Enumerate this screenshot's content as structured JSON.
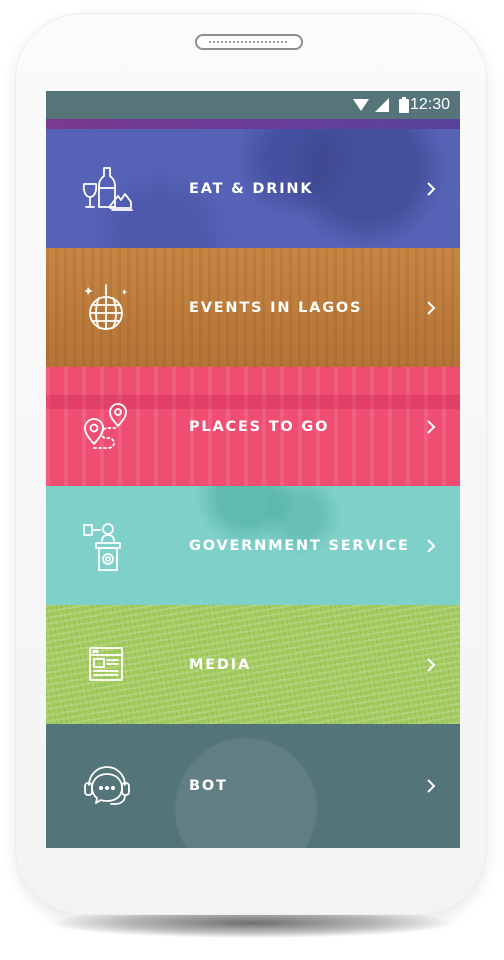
{
  "status_bar": {
    "time": "12:30",
    "icons": [
      "wifi-icon",
      "signal-icon",
      "battery-icon"
    ]
  },
  "menu": [
    {
      "id": "eat",
      "label": "EAT & DRINK",
      "icon": "wine-glass-bottle-icon",
      "color": "#5562b6"
    },
    {
      "id": "events",
      "label": "EVENTS IN LAGOS",
      "icon": "disco-ball-icon",
      "color": "#c4823f"
    },
    {
      "id": "places",
      "label": "PLACES TO GO",
      "icon": "map-pin-route-icon",
      "color": "#ef4d72"
    },
    {
      "id": "gov",
      "label": "GOVERNMENT SERVICE",
      "icon": "podium-microphone-icon",
      "color": "#7fd0c8"
    },
    {
      "id": "media",
      "label": "MEDIA",
      "icon": "newspaper-icon",
      "color": "#a3cb5f"
    },
    {
      "id": "bot",
      "label": "BOT",
      "icon": "headset-chat-icon",
      "color": "#537479"
    }
  ],
  "chevron_icon": "chevron-right-icon"
}
